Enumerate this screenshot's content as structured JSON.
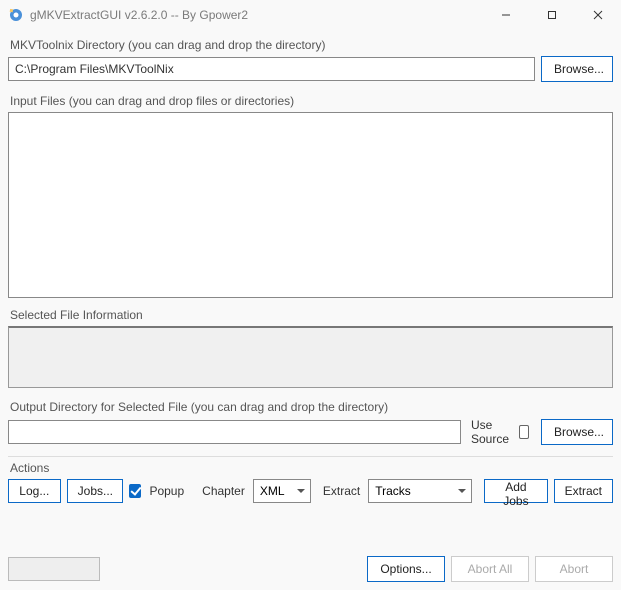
{
  "window": {
    "title": "gMKVExtractGUI v2.6.2.0 -- By Gpower2"
  },
  "sections": {
    "mkvtoolnix_dir_label": "MKVToolnix Directory (you can drag and drop the directory)",
    "mkvtoolnix_dir_value": "C:\\Program Files\\MKVToolNix",
    "browse_label": "Browse...",
    "input_files_label": "Input Files (you can drag and drop files or directories)",
    "selected_file_info_label": "Selected File Information",
    "output_dir_label": "Output Directory for Selected File (you can drag and drop the directory)",
    "output_dir_value": "",
    "use_source_label": "Use Source",
    "actions_label": "Actions"
  },
  "actions": {
    "log_label": "Log...",
    "jobs_label": "Jobs...",
    "popup_label": "Popup",
    "popup_checked": true,
    "chapter_label": "Chapter",
    "chapter_value": "XML",
    "extract_label_field": "Extract",
    "extract_value": "Tracks",
    "add_jobs_label": "Add Jobs",
    "extract_button_label": "Extract"
  },
  "bottom": {
    "options_label": "Options...",
    "abort_all_label": "Abort All",
    "abort_label": "Abort"
  }
}
